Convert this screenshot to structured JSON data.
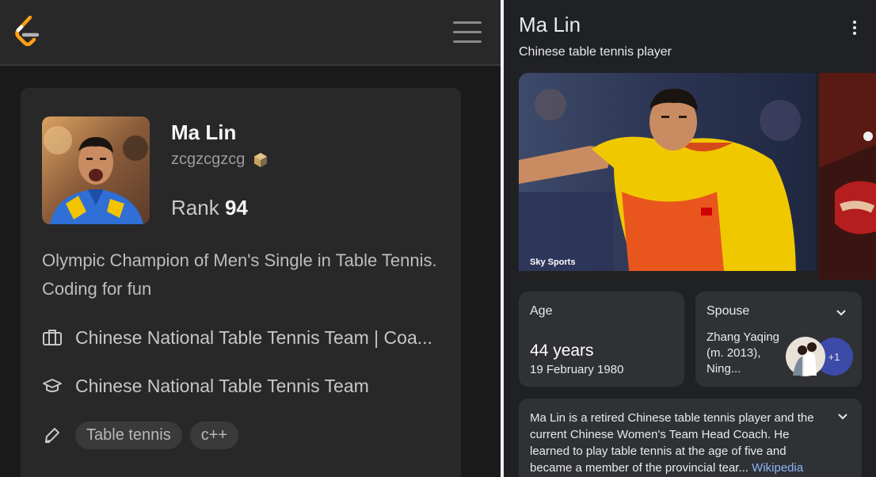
{
  "profile": {
    "name": "Ma Lin",
    "username": "zcgzcgzcg",
    "rank_label": "Rank",
    "rank_value": "94",
    "bio": "Olympic Champion of Men's Single in Table Tennis. Coding for fun",
    "company": "Chinese National Table Tennis Team | Coa...",
    "school": "Chinese National Table Tennis Team",
    "tags": [
      "Table tennis",
      "c++"
    ]
  },
  "knowledge": {
    "title": "Ma Lin",
    "subtitle": "Chinese table tennis player",
    "image_credit": "Sky Sports",
    "age_label": "Age",
    "age_value": "44 years",
    "birth_date": "19 February 1980",
    "spouse_label": "Spouse",
    "spouse_value": "Zhang Yaqing (m. 2013), Ning...",
    "spouse_more": "+1",
    "description": "Ma Lin is a retired Chinese table tennis player and the current Chinese Women's Team Head Coach. He learned to play table tennis at the age of five and became a member of the provincial tear...",
    "description_source": "Wikipedia"
  },
  "icons": {
    "logo": "leetcode-logo-icon",
    "menu": "hamburger-menu-icon",
    "badge": "badge-icon",
    "company": "briefcase-icon",
    "school": "graduation-cap-icon",
    "skills": "pen-icon",
    "options": "more-vert-icon",
    "expand": "chevron-down-icon"
  },
  "colors": {
    "left_bg": "#1a1a1a",
    "card_bg": "#282828",
    "logo_orange": "#ffa116",
    "google_bg": "#202124",
    "google_box": "#303134",
    "link_blue": "#8ab4f8"
  }
}
